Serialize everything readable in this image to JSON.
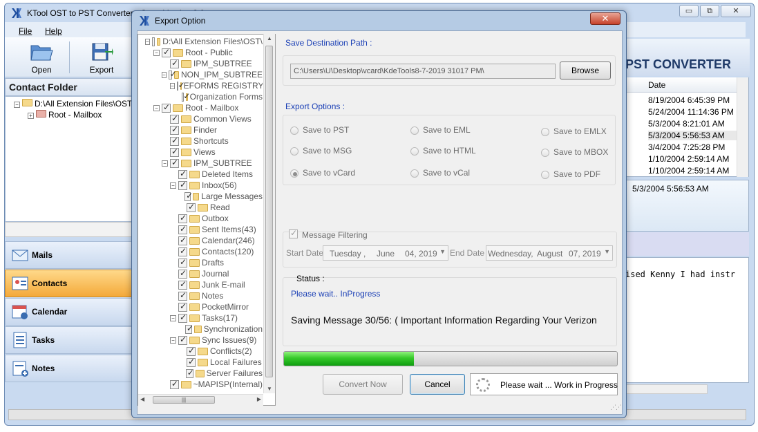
{
  "main_window": {
    "title": "KTool OST to PST Converter:- Open Version 3.0",
    "controls": {
      "minimize": "▭",
      "restore": "⧉",
      "close": "✕"
    },
    "menu": [
      "File",
      "Help"
    ],
    "toolbar": {
      "open_label": "Open",
      "export_label": "Export"
    },
    "brand_text": "PST CONVERTER",
    "contact_folder": {
      "header": "Contact Folder",
      "root": "D:\\All Extension Files\\OST\\",
      "child": "Root - Mailbox"
    },
    "nav": [
      {
        "label": "Mails",
        "icon": "mail-icon"
      },
      {
        "label": "Contacts",
        "icon": "contacts-icon"
      },
      {
        "label": "Calendar",
        "icon": "calendar-icon"
      },
      {
        "label": "Tasks",
        "icon": "tasks-icon"
      },
      {
        "label": "Notes",
        "icon": "notes-icon"
      }
    ],
    "active_nav": "Contacts",
    "grid": {
      "date_header": "Date",
      "dates": [
        "8/19/2004 6:45:39 PM",
        "5/24/2004 11:14:36 PM",
        "5/3/2004 8:21:01 AM",
        "5/3/2004 5:56:53 AM",
        "3/4/2004 7:25:28 PM",
        "1/10/2004 2:59:14 AM",
        "1/10/2004 2:59:14 AM"
      ]
    },
    "detail_date": "5/3/2004 5:56:53 AM",
    "body_excerpt": "ised Kenny I had instr"
  },
  "dialog": {
    "title": "Export Option",
    "close": "✕",
    "tree": [
      {
        "label": "D:\\All Extension Files\\OST\\",
        "indent": 0,
        "exp": "-",
        "checked": false
      },
      {
        "label": "Root - Public",
        "indent": 1,
        "exp": "-",
        "checked": true
      },
      {
        "label": "IPM_SUBTREE",
        "indent": 2,
        "exp": "",
        "checked": true
      },
      {
        "label": "NON_IPM_SUBTREE",
        "indent": 2,
        "exp": "-",
        "checked": true
      },
      {
        "label": "EFORMS REGISTRY",
        "indent": 3,
        "exp": "-",
        "checked": true
      },
      {
        "label": "Organization Forms",
        "indent": 4,
        "exp": "",
        "checked": true
      },
      {
        "label": "Root - Mailbox",
        "indent": 1,
        "exp": "-",
        "checked": true
      },
      {
        "label": "Common Views",
        "indent": 2,
        "exp": "",
        "checked": true
      },
      {
        "label": "Finder",
        "indent": 2,
        "exp": "",
        "checked": true
      },
      {
        "label": "Shortcuts",
        "indent": 2,
        "exp": "",
        "checked": true
      },
      {
        "label": "Views",
        "indent": 2,
        "exp": "",
        "checked": true
      },
      {
        "label": "IPM_SUBTREE",
        "indent": 2,
        "exp": "-",
        "checked": true
      },
      {
        "label": "Deleted Items",
        "indent": 3,
        "exp": "",
        "checked": true
      },
      {
        "label": "Inbox(56)",
        "indent": 3,
        "exp": "-",
        "checked": true
      },
      {
        "label": "Large Messages",
        "indent": 4,
        "exp": "",
        "checked": true
      },
      {
        "label": "Read",
        "indent": 4,
        "exp": "",
        "checked": true
      },
      {
        "label": "Outbox",
        "indent": 3,
        "exp": "",
        "checked": true
      },
      {
        "label": "Sent Items(43)",
        "indent": 3,
        "exp": "",
        "checked": true
      },
      {
        "label": "Calendar(246)",
        "indent": 3,
        "exp": "",
        "checked": true
      },
      {
        "label": "Contacts(120)",
        "indent": 3,
        "exp": "",
        "checked": true
      },
      {
        "label": "Drafts",
        "indent": 3,
        "exp": "",
        "checked": true
      },
      {
        "label": "Journal",
        "indent": 3,
        "exp": "",
        "checked": true
      },
      {
        "label": "Junk E-mail",
        "indent": 3,
        "exp": "",
        "checked": true
      },
      {
        "label": "Notes",
        "indent": 3,
        "exp": "",
        "checked": true
      },
      {
        "label": "PocketMirror",
        "indent": 3,
        "exp": "",
        "checked": true
      },
      {
        "label": "Tasks(17)",
        "indent": 3,
        "exp": "-",
        "checked": true
      },
      {
        "label": "Synchronization",
        "indent": 4,
        "exp": "",
        "checked": true
      },
      {
        "label": "Sync Issues(9)",
        "indent": 3,
        "exp": "-",
        "checked": true
      },
      {
        "label": "Conflicts(2)",
        "indent": 4,
        "exp": "",
        "checked": true
      },
      {
        "label": "Local Failures",
        "indent": 4,
        "exp": "",
        "checked": true
      },
      {
        "label": "Server Failures",
        "indent": 4,
        "exp": "",
        "checked": true
      },
      {
        "label": "~MAPISP(Internal)",
        "indent": 2,
        "exp": "",
        "checked": true
      }
    ],
    "save_path_label": "Save Destination Path :",
    "save_path": "C:\\Users\\U\\Desktop\\vcard\\KdeTools8-7-2019 31017 PM\\",
    "browse_label": "Browse",
    "export_options_label": "Export Options :",
    "options": [
      {
        "label": "Save to PST",
        "selected": false
      },
      {
        "label": "Save to EML",
        "selected": false
      },
      {
        "label": "Save to EMLX",
        "selected": false
      },
      {
        "label": "Save to MSG",
        "selected": false
      },
      {
        "label": "Save to HTML",
        "selected": false
      },
      {
        "label": "Save to MBOX",
        "selected": false
      },
      {
        "label": "Save to vCard",
        "selected": true
      },
      {
        "label": "Save to vCal",
        "selected": false
      },
      {
        "label": "Save to PDF",
        "selected": false
      }
    ],
    "message_filtering_label": "Message Filtering",
    "start_date_label": "Start Date",
    "start_date": {
      "weekday": "Tuesday",
      "month": "June",
      "day_year": "04, 2019"
    },
    "end_date_label": "End Date",
    "end_date": {
      "weekday": "Wednesday,",
      "month": "August",
      "day_year": "07, 2019"
    },
    "status_label": "Status :",
    "status_text": "Please wait.. InProgress",
    "saving_text": "Saving Message 30/56: ( Important Information Regarding Your Verizon",
    "progress": 0.39,
    "convert_label": "Convert Now",
    "cancel_label": "Cancel",
    "wait_text": "Please wait ... Work in Progress"
  }
}
